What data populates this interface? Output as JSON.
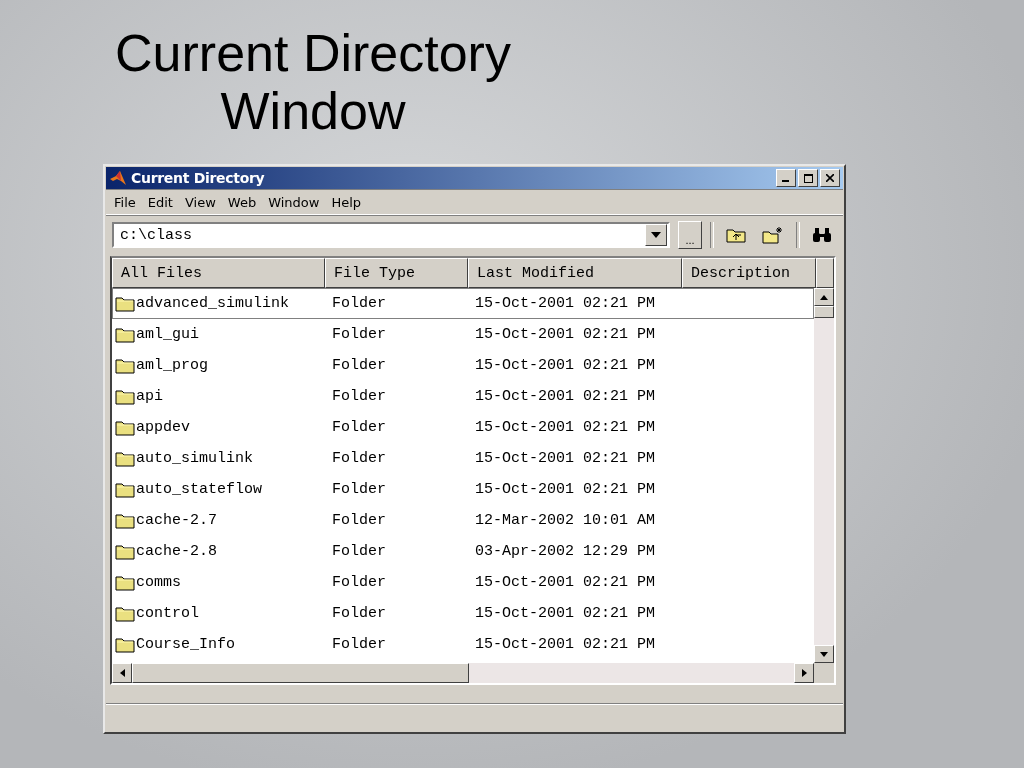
{
  "slide": {
    "title_lines": [
      "Current Directory",
      "Window"
    ]
  },
  "window": {
    "title": "Current Directory"
  },
  "menu": [
    "File",
    "Edit",
    "View",
    "Web",
    "Window",
    "Help"
  ],
  "path_field": {
    "value": "c:\\class"
  },
  "browse_button": {
    "label": "..."
  },
  "table": {
    "columns": [
      "All Files",
      "File Type",
      "Last Modified",
      "Description"
    ],
    "rows": [
      {
        "name": "advanced_simulink",
        "type": "Folder",
        "modified": "15-Oct-2001 02:21 PM",
        "selected": true
      },
      {
        "name": "aml_gui",
        "type": "Folder",
        "modified": "15-Oct-2001 02:21 PM",
        "selected": false
      },
      {
        "name": "aml_prog",
        "type": "Folder",
        "modified": "15-Oct-2001 02:21 PM",
        "selected": false
      },
      {
        "name": "api",
        "type": "Folder",
        "modified": "15-Oct-2001 02:21 PM",
        "selected": false
      },
      {
        "name": "appdev",
        "type": "Folder",
        "modified": "15-Oct-2001 02:21 PM",
        "selected": false
      },
      {
        "name": "auto_simulink",
        "type": "Folder",
        "modified": "15-Oct-2001 02:21 PM",
        "selected": false
      },
      {
        "name": "auto_stateflow",
        "type": "Folder",
        "modified": "15-Oct-2001 02:21 PM",
        "selected": false
      },
      {
        "name": "cache-2.7",
        "type": "Folder",
        "modified": "12-Mar-2002 10:01 AM",
        "selected": false
      },
      {
        "name": "cache-2.8",
        "type": "Folder",
        "modified": "03-Apr-2002 12:29 PM",
        "selected": false
      },
      {
        "name": "comms",
        "type": "Folder",
        "modified": "15-Oct-2001 02:21 PM",
        "selected": false
      },
      {
        "name": "control",
        "type": "Folder",
        "modified": "15-Oct-2001 02:21 PM",
        "selected": false
      },
      {
        "name": "Course_Info",
        "type": "Folder",
        "modified": "15-Oct-2001 02:21 PM",
        "selected": false
      }
    ]
  }
}
